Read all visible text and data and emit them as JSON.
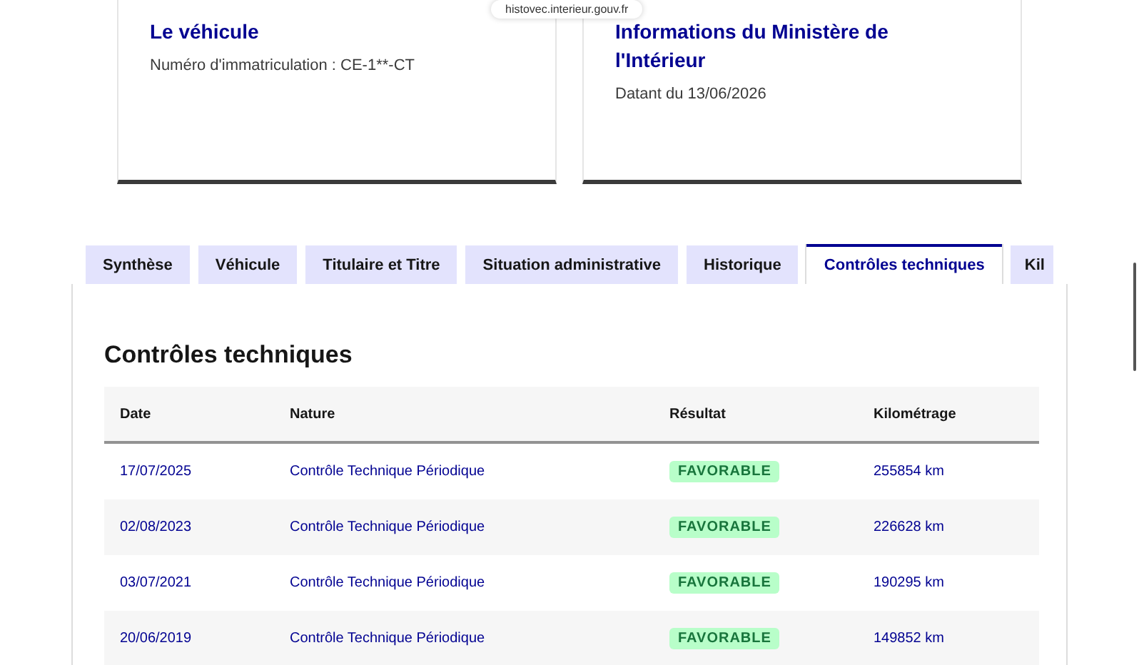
{
  "address_bar": {
    "url": "histovec.interieur.gouv.fr"
  },
  "cards": [
    {
      "title": "Le véhicule",
      "text": "Numéro d'immatriculation : CE-1**-CT"
    },
    {
      "title": "Informations du Ministère de l'Intérieur",
      "text": "Datant du 13/06/2026"
    }
  ],
  "tabs": [
    {
      "label": "Synthèse",
      "selected": false
    },
    {
      "label": "Véhicule",
      "selected": false
    },
    {
      "label": "Titulaire et Titre",
      "selected": false
    },
    {
      "label": "Situation administrative",
      "selected": false
    },
    {
      "label": "Historique",
      "selected": false
    },
    {
      "label": "Contrôles techniques",
      "selected": true
    },
    {
      "label": "Kil",
      "selected": false
    }
  ],
  "section": {
    "title": "Contrôles techniques"
  },
  "table": {
    "columns": [
      "Date",
      "Nature",
      "Résultat",
      "Kilométrage"
    ],
    "rows": [
      {
        "date": "17/07/2025",
        "nature": "Contrôle Technique Périodique",
        "result": "FAVORABLE",
        "mileage": "255854 km"
      },
      {
        "date": "02/08/2023",
        "nature": "Contrôle Technique Périodique",
        "result": "FAVORABLE",
        "mileage": "226628 km"
      },
      {
        "date": "03/07/2021",
        "nature": "Contrôle Technique Périodique",
        "result": "FAVORABLE",
        "mileage": "190295 km"
      },
      {
        "date": "20/06/2019",
        "nature": "Contrôle Technique Périodique",
        "result": "FAVORABLE",
        "mileage": "149852 km"
      }
    ]
  }
}
